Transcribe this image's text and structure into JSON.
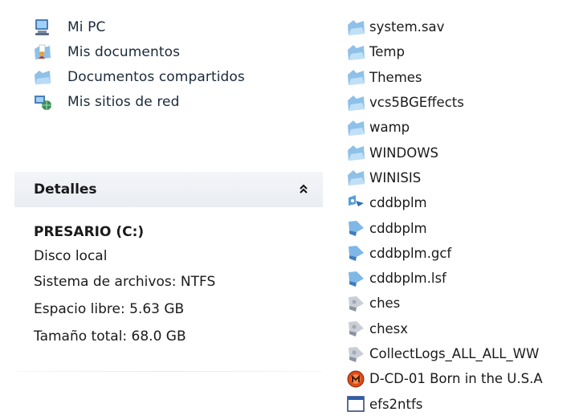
{
  "places": [
    {
      "label": "Mi PC",
      "icon": "computer-icon"
    },
    {
      "label": "Mis documentos",
      "icon": "documents-folder-icon"
    },
    {
      "label": "Documentos compartidos",
      "icon": "shared-folder-icon"
    },
    {
      "label": "Mis sitios de red",
      "icon": "network-places-icon"
    }
  ],
  "details": {
    "title": "Detalles",
    "collapse_glyph": "˄˄",
    "drive_name": "PRESARIO (C:)",
    "drive_type": "Disco local",
    "filesystem": "Sistema de archivos: NTFS",
    "free_space": "Espacio libre: 5.63 GB",
    "total_size": "Tamaño total: 68.0 GB"
  },
  "files": [
    {
      "label": "system.sav",
      "icon": "folder-icon"
    },
    {
      "label": "Temp",
      "icon": "folder-icon"
    },
    {
      "label": "Themes",
      "icon": "folder-icon"
    },
    {
      "label": "vcs5BGEffects",
      "icon": "folder-icon"
    },
    {
      "label": "wamp",
      "icon": "folder-icon"
    },
    {
      "label": "WINDOWS",
      "icon": "folder-icon"
    },
    {
      "label": "WINISIS",
      "icon": "folder-icon"
    },
    {
      "label": "cddbplm",
      "icon": "setup-icon"
    },
    {
      "label": "cddbplm",
      "icon": "config-file-icon"
    },
    {
      "label": "cddbplm.gcf",
      "icon": "config-file-icon"
    },
    {
      "label": "cddbplm.lsf",
      "icon": "config-file-icon"
    },
    {
      "label": "ches",
      "icon": "system-file-icon"
    },
    {
      "label": "chesx",
      "icon": "system-file-icon"
    },
    {
      "label": "CollectLogs_ALL_ALL_WW",
      "icon": "system-file-icon"
    },
    {
      "label": "D-CD-01 Born in the U.S.A",
      "icon": "media-file-icon"
    },
    {
      "label": "efs2ntfs",
      "icon": "application-window-icon"
    }
  ],
  "colors": {
    "folder": "#8fc1e8",
    "accent": "#3a78c8",
    "details_header": "#eceff3",
    "media": "#e04a1a"
  }
}
